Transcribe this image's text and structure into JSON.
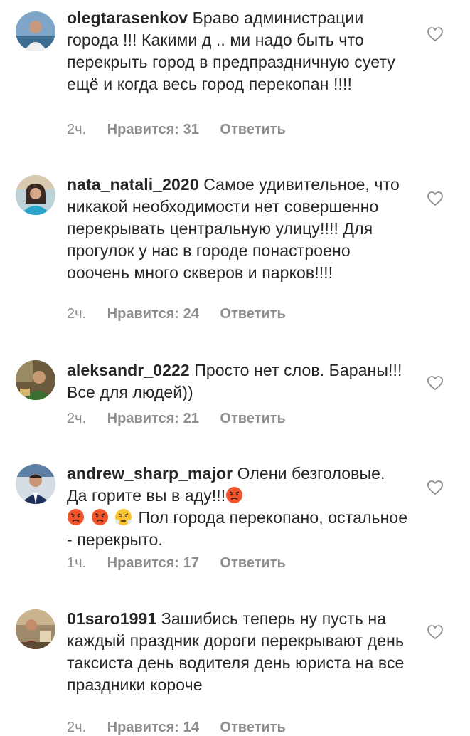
{
  "comments": [
    {
      "username": "olegtarasenkov",
      "text": "Браво администрации города !!! Какими д .. ми надо быть что перекрыть город в предпраздничную суету ещё и когда весь город перекопан !!!!",
      "time": "2ч.",
      "likes": "Нравится: 31",
      "reply": "Ответить",
      "avatar_icon": "user-avatar"
    },
    {
      "username": "nata_natali_2020",
      "text": "Самое удивительное, что никакой необходимости нет совершенно перекрывать центральную улицу!!!! Для прогулок  у нас в городе понастроено ооочень много скверов и парков!!!!",
      "time": "2ч.",
      "likes": "Нравится: 24",
      "reply": "Ответить",
      "avatar_icon": "user-avatar"
    },
    {
      "username": "aleksandr_0222",
      "text": "Просто нет слов. Бараны!!! Все для людей))",
      "time": "2ч.",
      "likes": "Нравится: 21",
      "reply": "Ответить",
      "avatar_icon": "user-avatar"
    },
    {
      "username": "andrew_sharp_major",
      "text_before": "Олени безголовые. Да горите вы в аду!!!",
      "text_after": " Пол города перекопано, остальное - перекрыто.",
      "emojis": [
        "angry-face-emoji",
        "angry-face-emoji",
        "angry-face-emoji",
        "steam-from-nose-emoji"
      ],
      "time": "1ч.",
      "likes": "Нравится: 17",
      "reply": "Ответить",
      "avatar_icon": "user-avatar"
    },
    {
      "username": "01saro1991",
      "text": "Зашибись теперь ну пусть на каждый праздник дороги перекрывают день таксиста день водителя день юриста на все праздники короче",
      "time": "2ч.",
      "likes": "Нравится: 14",
      "reply": "Ответить",
      "avatar_icon": "user-avatar"
    }
  ],
  "colors": {
    "text": "#262626",
    "meta": "#8e8e8e",
    "heart_stroke": "#8e8e8e",
    "background": "#ffffff"
  },
  "icons": {
    "like": "heart-outline-icon"
  }
}
